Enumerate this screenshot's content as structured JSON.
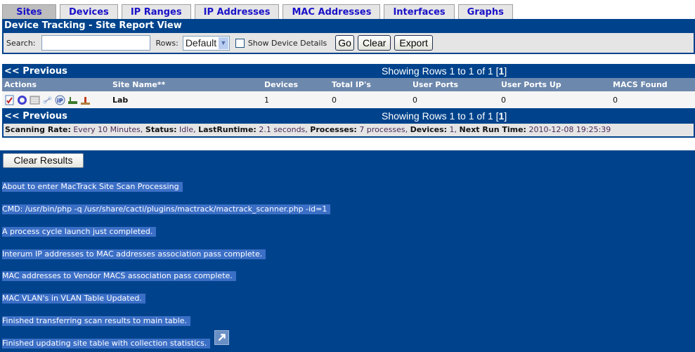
{
  "tabs": [
    "Sites",
    "Devices",
    "IP Ranges",
    "IP Addresses",
    "MAC Addresses",
    "Interfaces",
    "Graphs"
  ],
  "active_tab": "Sites",
  "title": "Device Tracking - Site Report View",
  "filter": {
    "search_label": "Search:",
    "search_value": "",
    "rows_label": "Rows:",
    "rows_value": "Default",
    "show_details_label": "Show Device Details",
    "show_details_checked": false,
    "go": "Go",
    "clear": "Clear",
    "export": "Export"
  },
  "nav": {
    "previous": "<< Previous",
    "showing": "Showing Rows 1 to 1 of 1 [",
    "page": "1",
    "close": "]"
  },
  "table": {
    "columns": [
      "Actions",
      "Site Name**",
      "Devices",
      "Total IP's",
      "User Ports",
      "User Ports Up",
      "MACS Found"
    ],
    "rows": [
      {
        "icons": [
          "edit-icon",
          "scan-icon",
          "devices-icon",
          "network-icon",
          "ip-icon",
          "interfaces-icon",
          "graph-icon"
        ],
        "site": "Lab",
        "devices": "1",
        "total_ips": "0",
        "user_ports": "0",
        "user_ports_up": "0",
        "macs": "0"
      }
    ]
  },
  "status": {
    "k1": "Scanning Rate:",
    "v1": "Every 10 Minutes,",
    "k2": "Status:",
    "v2": "Idle,",
    "k3": "LastRuntime:",
    "v3": "2.1 seconds,",
    "k4": "Processes:",
    "v4": "7 processes,",
    "k5": "Devices:",
    "v5": "1,",
    "k6": "Next Run Time:",
    "v6": "2010-12-08 19:25:39"
  },
  "results": {
    "clear_label": "Clear Results",
    "lines": [
      "About to enter MacTrack Site Scan Processing",
      "CMD: /usr/bin/php -q /usr/share/cacti/plugins/mactrack/mactrack_scanner.php -id=1",
      "A process cycle launch just completed.",
      "Interum IP addresses to MAC addresses association pass complete.",
      "MAC addresses to Vendor MACS association pass complete.",
      "MAC VLAN's in VLAN Table Updated.",
      "Finished transferring scan results to main table.",
      "Finished updating site table with collection statistics."
    ]
  },
  "colors": {
    "header": "#00438c",
    "subheader": "#6d88ad",
    "tab_text": "#1a12c8",
    "highlight": "#3b6fc6"
  }
}
